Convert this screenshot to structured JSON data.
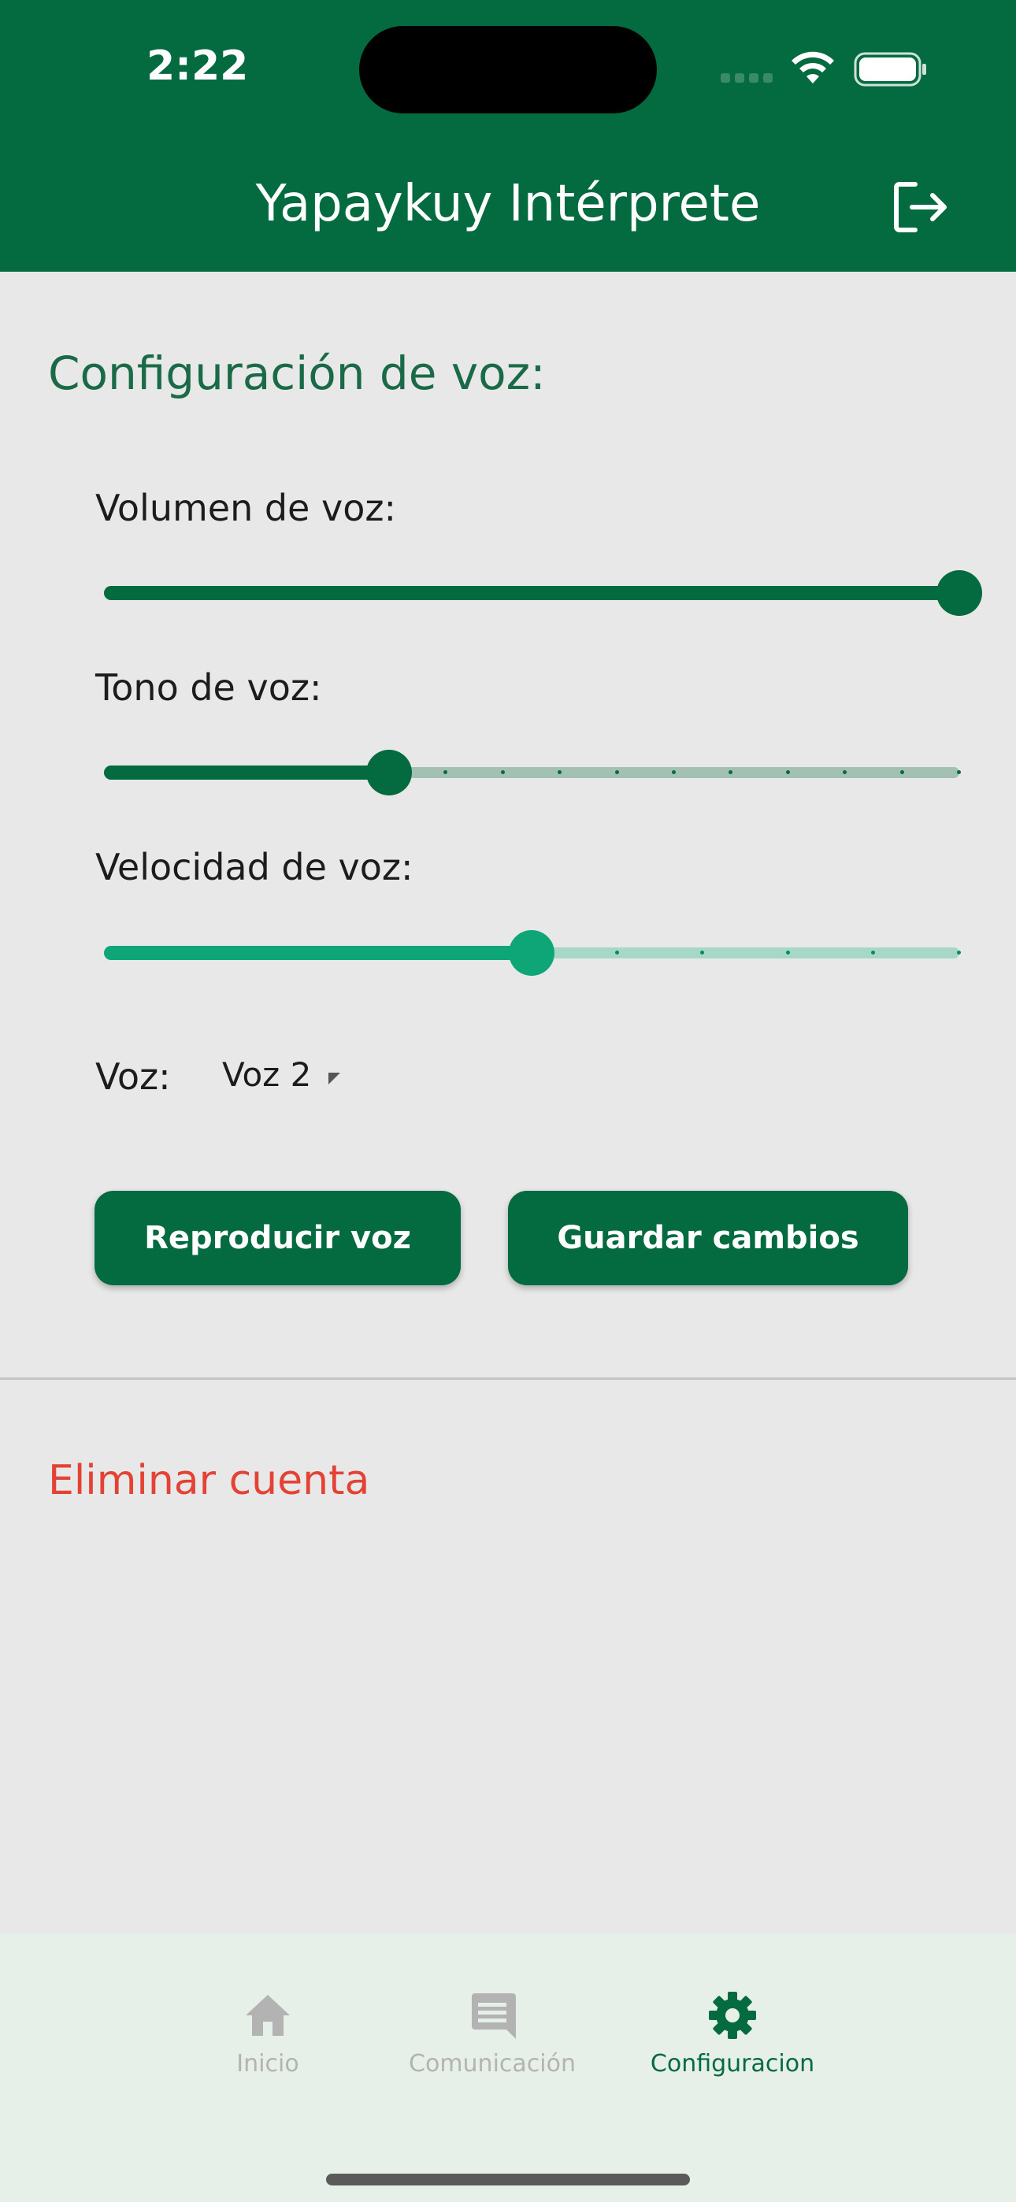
{
  "status_bar": {
    "time": "2:22"
  },
  "header": {
    "title": "Yapaykuy Intérprete",
    "logout_icon": "logout-icon"
  },
  "settings": {
    "section_title": "Configuración de voz:",
    "volume": {
      "label": "Volumen de voz:",
      "value": 1.0
    },
    "pitch": {
      "label": "Tono de voz:",
      "value": 0.333,
      "divisions": 15
    },
    "speed": {
      "label": "Velocidad de voz:",
      "value": 0.5,
      "divisions": 10
    },
    "voice": {
      "label": "Voz:",
      "selected": "Voz 2"
    },
    "play_button": "Reproducir voz",
    "save_button": "Guardar cambios"
  },
  "delete_account": "Eliminar cuenta",
  "bottom_nav": {
    "items": [
      {
        "label": "Inicio",
        "icon": "home-icon",
        "active": false
      },
      {
        "label": "Comunicación",
        "icon": "chat-icon",
        "active": false
      },
      {
        "label": "Configuracion",
        "icon": "gear-icon",
        "active": true
      }
    ]
  },
  "colors": {
    "primary": "#046a3f",
    "accent": "#0ea676",
    "danger": "#e34234",
    "nav_inactive": "#b3b3b3"
  }
}
